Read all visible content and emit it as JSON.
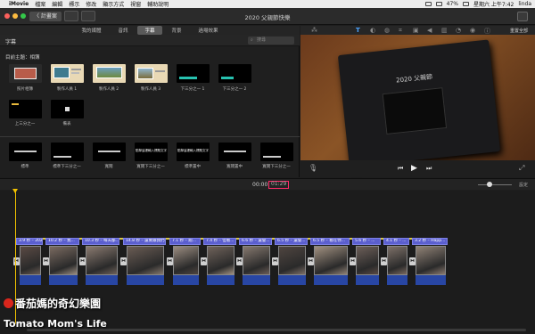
{
  "menubar": {
    "apple": "",
    "app": "iMovie",
    "items": [
      "檔案",
      "編輯",
      "標示",
      "修改",
      "顯示方式",
      "視窗",
      "輔助說明"
    ],
    "battery": "47%",
    "clock": "星期六 上午7:42",
    "user": "linda"
  },
  "toolbar": {
    "back_label": "〈 計畫案",
    "window_title": "2020 父親節快樂"
  },
  "tabs": [
    "我的媒體",
    "音訊",
    "字幕",
    "背景",
    "過場效果"
  ],
  "active_tab": "字幕",
  "browser": {
    "header": "字幕",
    "search_placeholder": "搜尋",
    "section_label": "目前主題：相簿",
    "row1": [
      "照片相簿",
      "製作人員 1",
      "製作人員 2",
      "製作人員 3",
      "下三分之一 1",
      "下三分之一 2"
    ],
    "row2": [
      "上三分之一",
      "備表"
    ],
    "row3": [
      "標準",
      "標準下三分之一",
      "寬闊",
      "寬闊下三分之一",
      "標準置中",
      "寬闊置中",
      "寬闊下三分之一"
    ],
    "row3_thumb_text": "點擊這裡輸入標題文字"
  },
  "viewer": {
    "reset_label": "重置全部",
    "book_title": "2020 父親節"
  },
  "timeline": {
    "current_time": "00:00",
    "duration": "01:29",
    "settings_label": "設定",
    "clip_titles": [
      "3.9 秒 – 2020...",
      "10.2 秒 – 我...",
      "10.3 秒 – 每天都...",
      "14.8 秒 – 還要跟我們爸...",
      "7.1 秒 – 跑...",
      "7.4 秒 – 但看...",
      "6.6 秒 – 還會...",
      "6.5 秒 – 還會...",
      "6.5 秒 – 看在你...",
      "5.6 秒 – ...",
      "4.1 秒 – ...",
      "3.2 秒 – Happ..."
    ]
  },
  "watermark": {
    "line1": "番茄媽的奇幻樂園",
    "line2": "Tomato Mom's Life"
  },
  "colors": {
    "clip_bar": "#5b5fcf",
    "audio": "#2846a4",
    "playhead": "#f2c200",
    "duration_highlight": "#ff2c6a"
  }
}
